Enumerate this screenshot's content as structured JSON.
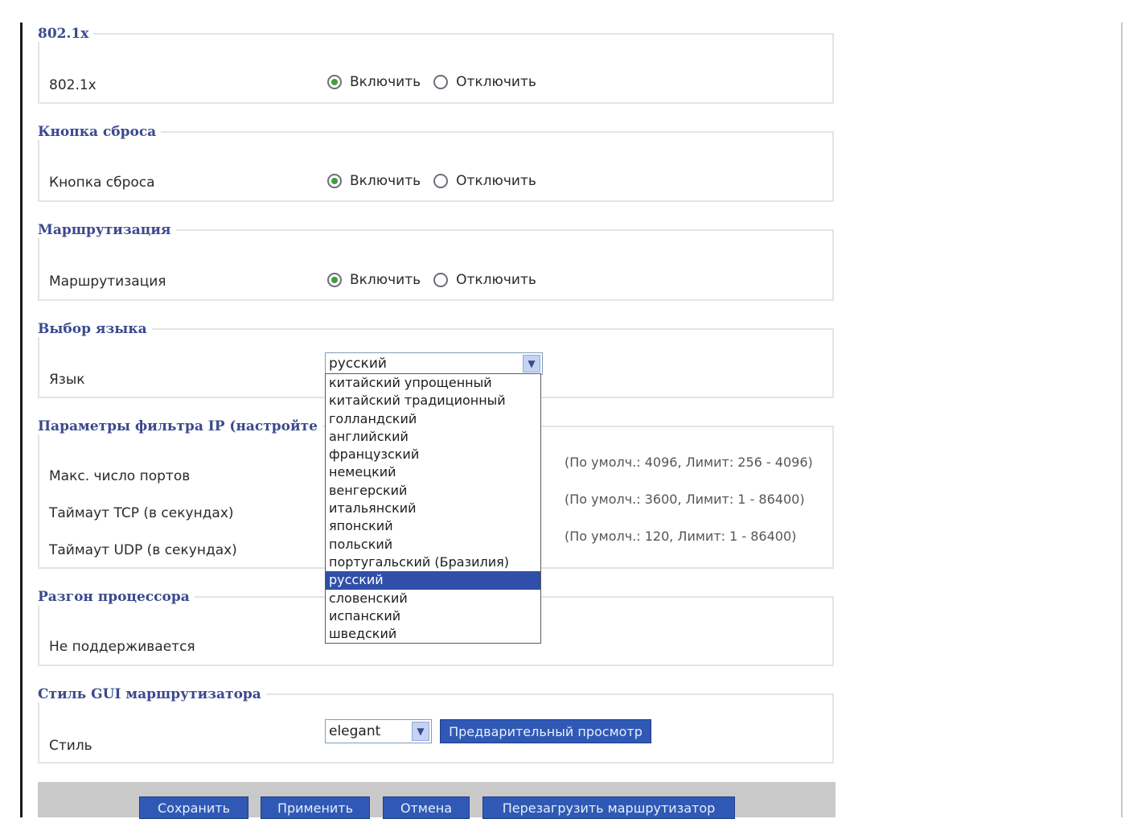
{
  "sections": {
    "dot1x": {
      "legend": "802.1x",
      "label": "802.1x",
      "enable": "Включить",
      "disable": "Отключить"
    },
    "reset_button": {
      "legend": "Кнопка сброса",
      "label": "Кнопка сброса",
      "enable": "Включить",
      "disable": "Отключить"
    },
    "routing": {
      "legend": "Маршрутизация",
      "label": "Маршрутизация",
      "enable": "Включить",
      "disable": "Отключить"
    },
    "language": {
      "legend": "Выбор языка",
      "label": "Язык",
      "selected": "русский",
      "options": [
        "китайский упрощенный",
        "китайский традиционный",
        "голландский",
        "английский",
        "французский",
        "немецкий",
        "венгерский",
        "итальянский",
        "японский",
        "польский",
        "португальский (Бразилия)",
        "русский",
        "словенский",
        "испанский",
        "шведский"
      ]
    },
    "ip_filter": {
      "legend": "Параметры фильтра IP (настройте",
      "rows": [
        {
          "label": "Макс. число портов",
          "hint": "(По умолч.: 4096, Лимит: 256 - 4096)"
        },
        {
          "label": "Таймаут TCP (в секундах)",
          "hint": "(По умолч.: 3600, Лимит: 1 - 86400)"
        },
        {
          "label": "Таймаут UDP (в секундах)",
          "hint": "(По умолч.: 120, Лимит: 1 - 86400)"
        }
      ]
    },
    "overclock": {
      "legend": "Разгон процессора",
      "label": "Не поддерживается"
    },
    "gui_style": {
      "legend": "Стиль GUI маршрутизатора",
      "label": "Стиль",
      "selected": "elegant",
      "preview_button": "Предварительный просмотр"
    }
  },
  "footer": {
    "save": "Сохранить",
    "apply": "Применить",
    "cancel": "Отмена",
    "reboot": "Перезагрузить маршрутизатор"
  },
  "colors": {
    "legend": "#3a4a8e",
    "button": "#2f59b5",
    "selection": "#2f4fa8",
    "radio_on": "#3f9f3a"
  }
}
